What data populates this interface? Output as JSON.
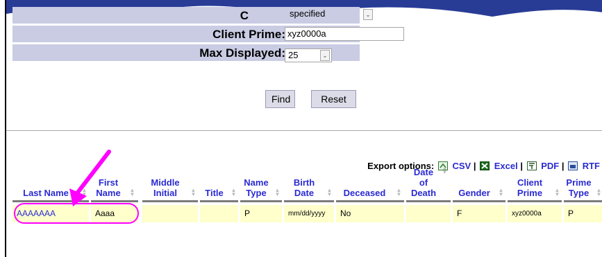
{
  "form": {
    "status_label": "C",
    "status_value": "specified",
    "client_prime_label": "Client Prime:",
    "client_prime_value": "xyz0000a",
    "max_displayed_label": "Max Displayed:",
    "max_displayed_value": "25"
  },
  "buttons": {
    "find": "Find",
    "reset": "Reset"
  },
  "export": {
    "label": "Export options:",
    "csv": "CSV",
    "excel": "Excel",
    "pdf": "PDF",
    "rtf": "RTF",
    "sep": "|"
  },
  "table": {
    "headers": [
      {
        "l1": "",
        "l2": "Last Name"
      },
      {
        "l1": "First",
        "l2": "Name"
      },
      {
        "l1": "Middle",
        "l2": "Initial"
      },
      {
        "l1": "",
        "l2": "Title"
      },
      {
        "l1": "Name",
        "l2": "Type"
      },
      {
        "l1": "Birth",
        "l2": "Date"
      },
      {
        "l1": "",
        "l2": "Deceased"
      },
      {
        "l1": "Date",
        "l2": "of",
        "l3": "Death"
      },
      {
        "l1": "",
        "l2": "Gender"
      },
      {
        "l1": "Client",
        "l2": "Prime"
      },
      {
        "l1": "Prime",
        "l2": "Type"
      }
    ],
    "row": [
      "AAAAAAA",
      "Aaaa",
      "",
      "",
      "P",
      "mm/dd/yyyy",
      "No",
      "",
      "F",
      "xyz0000a",
      "P"
    ]
  },
  "colors": {
    "annotation": "#ff00ff",
    "link": "#2a2ad2",
    "row_bg": "#ffffcc",
    "form_bg": "#c9cce3"
  },
  "icons": [
    "csv-icon",
    "excel-icon",
    "pdf-icon",
    "rtf-icon",
    "sort-icon"
  ]
}
